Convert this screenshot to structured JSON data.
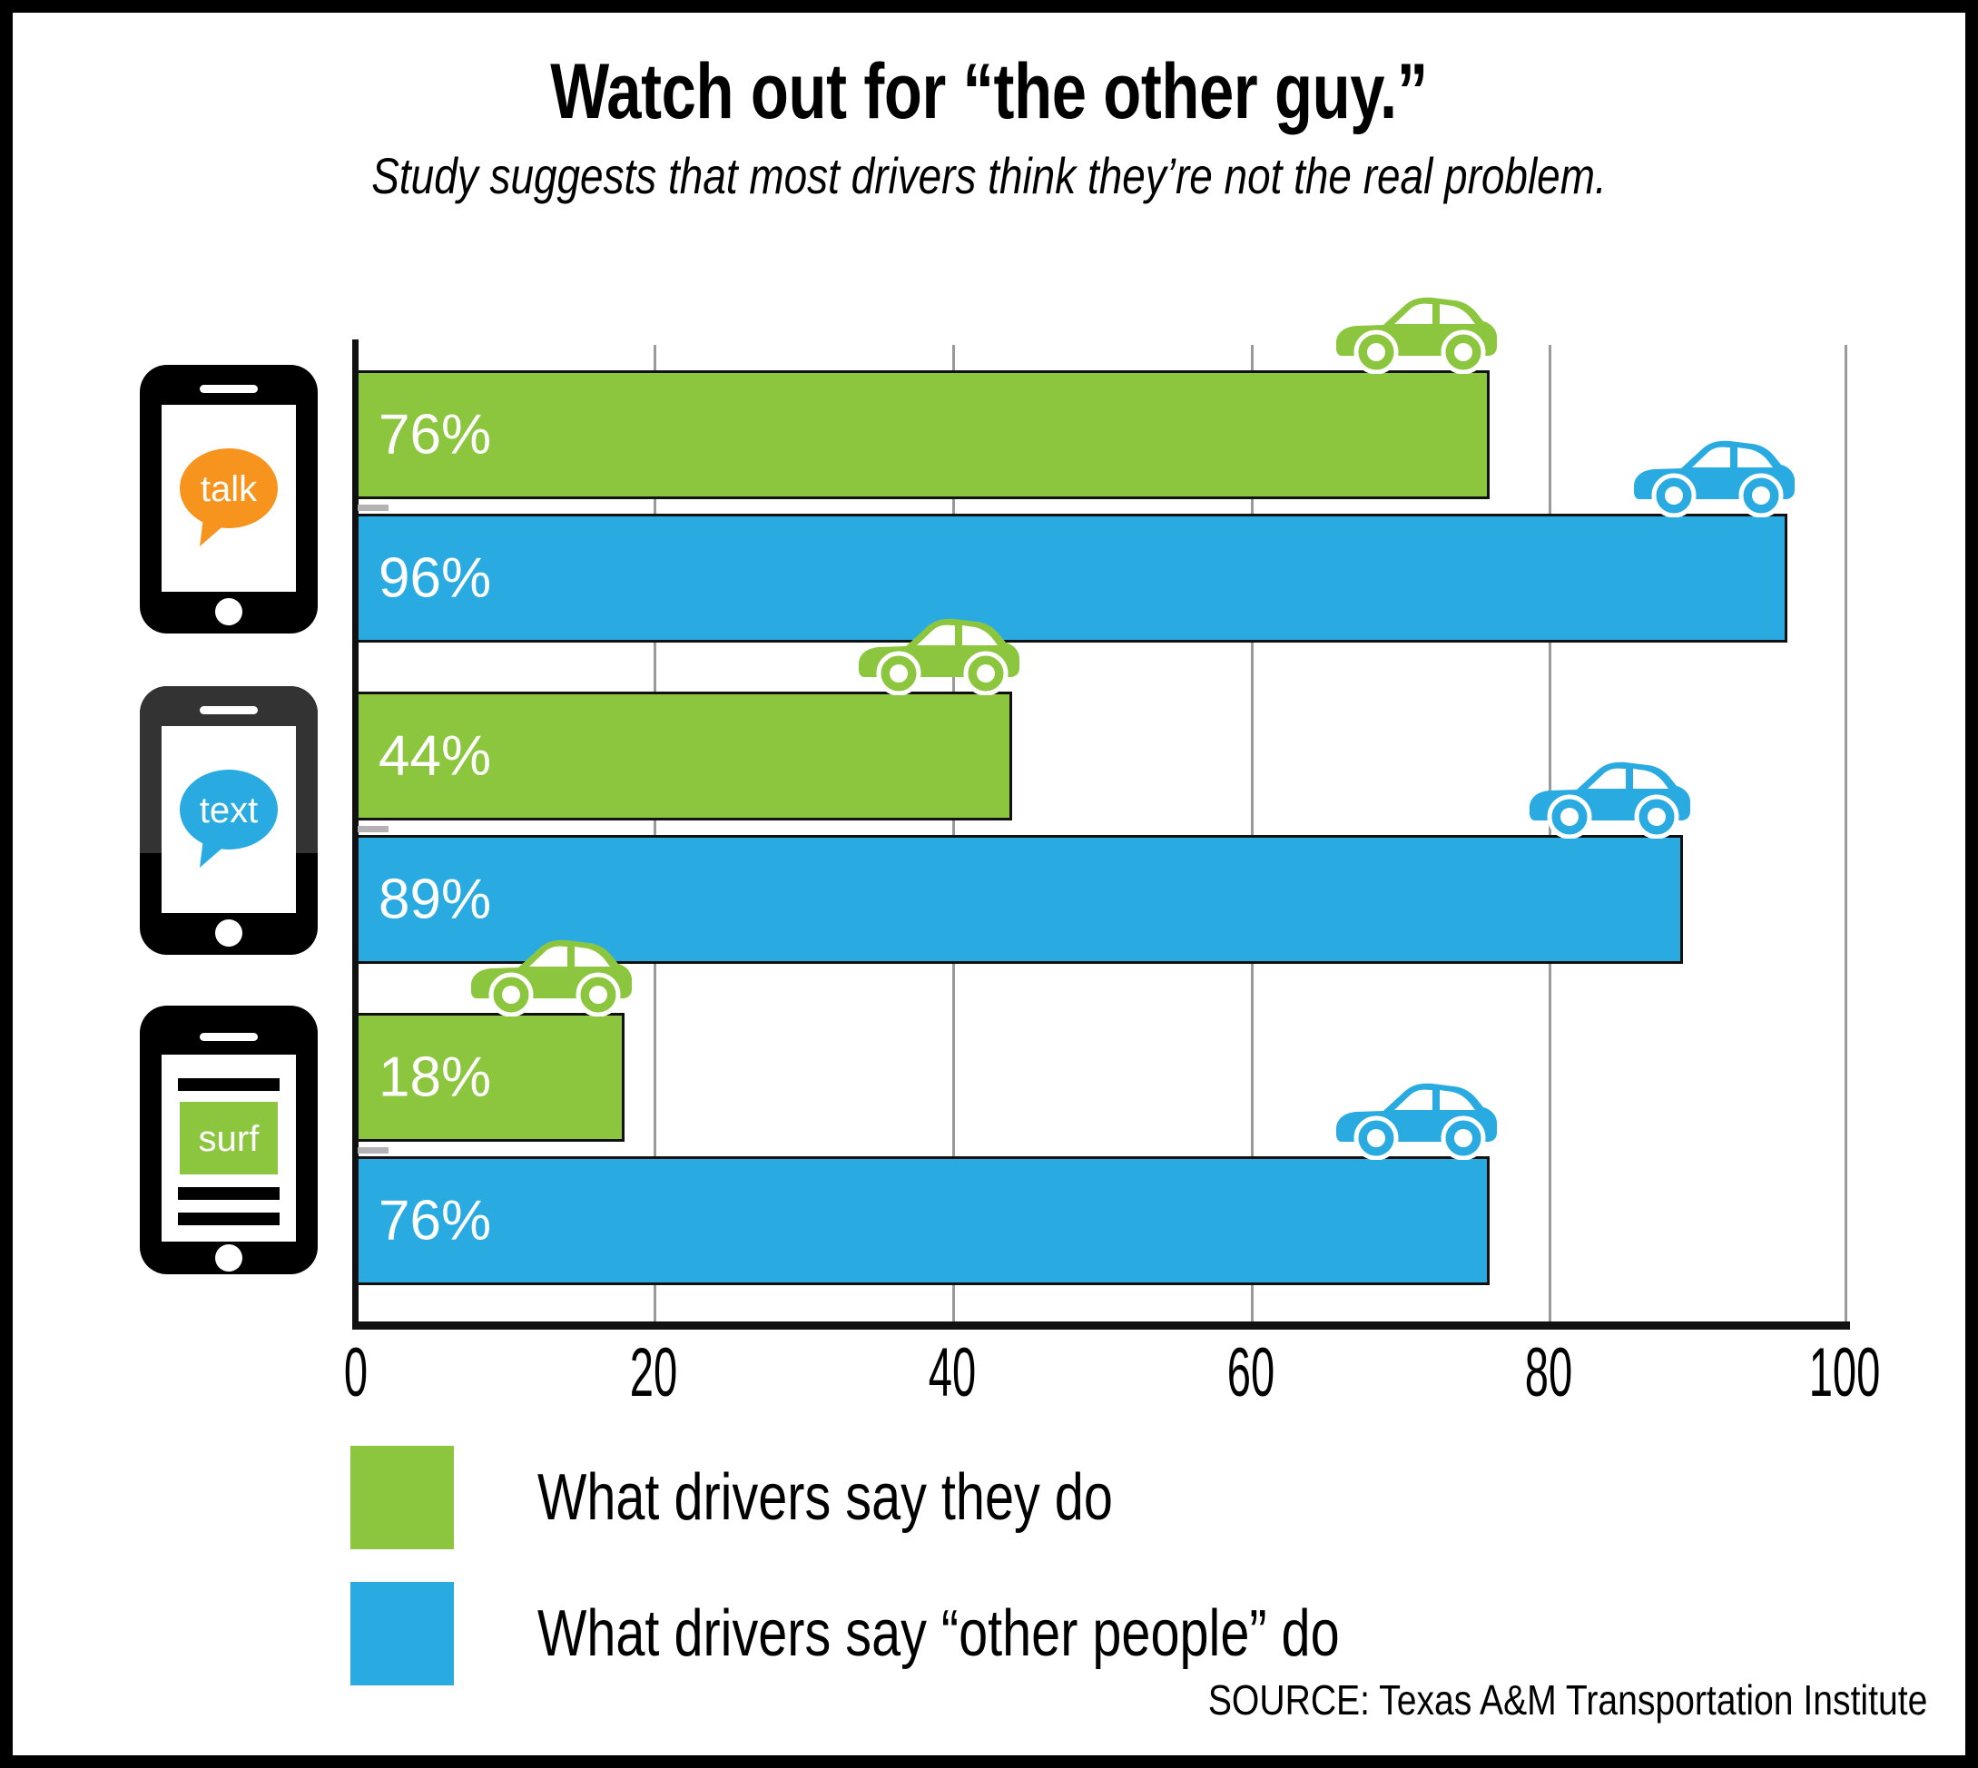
{
  "header": {
    "title": "Watch out for “the other guy.”",
    "subtitle": "Study suggests that most drivers think they’re not the real problem."
  },
  "colors": {
    "green": "#8CC63F",
    "blue": "#29ABE2",
    "orange": "#F7941E",
    "black": "#000000",
    "gridline": "#9A9A9A"
  },
  "categories": [
    {
      "key": "talk",
      "phone_label": "talk",
      "phone_style": "speech-bubble-orange"
    },
    {
      "key": "text",
      "phone_label": "text",
      "phone_style": "speech-bubble-blue"
    },
    {
      "key": "surf",
      "phone_label": "surf",
      "phone_style": "browser-green"
    }
  ],
  "bars": [
    {
      "category": "talk",
      "series": "self",
      "value": 76,
      "label": "76%"
    },
    {
      "category": "talk",
      "series": "other",
      "value": 96,
      "label": "96%"
    },
    {
      "category": "text",
      "series": "self",
      "value": 44,
      "label": "44%"
    },
    {
      "category": "text",
      "series": "other",
      "value": 89,
      "label": "89%"
    },
    {
      "category": "surf",
      "series": "self",
      "value": 18,
      "label": "18%"
    },
    {
      "category": "surf",
      "series": "other",
      "value": 76,
      "label": "76%"
    }
  ],
  "axis": {
    "ticks": [
      "0",
      "20",
      "40",
      "60",
      "80",
      "100"
    ],
    "min": 0,
    "max": 100
  },
  "legend": [
    {
      "color": "green",
      "label": "What drivers say they do"
    },
    {
      "color": "blue",
      "label": "What drivers say “other people” do"
    }
  ],
  "source": "SOURCE: Texas A&M Transportation Institute",
  "chart_data": {
    "type": "bar",
    "orientation": "horizontal",
    "title": "Watch out for “the other guy.”",
    "subtitle": "Study suggests that most drivers think they’re not the real problem.",
    "categories": [
      "talk",
      "text",
      "surf"
    ],
    "series": [
      {
        "name": "What drivers say they do",
        "color": "#8CC63F",
        "values": [
          76,
          44,
          18
        ]
      },
      {
        "name": "What drivers say “other people” do",
        "color": "#29ABE2",
        "values": [
          96,
          89,
          76
        ]
      }
    ],
    "xlabel": "",
    "ylabel": "",
    "xlim": [
      0,
      100
    ],
    "xticks": [
      0,
      20,
      40,
      60,
      80,
      100
    ],
    "grid": true,
    "grid_axis": "x",
    "legend_position": "bottom-left",
    "data_labels": [
      "76%",
      "96%",
      "44%",
      "89%",
      "18%",
      "76%"
    ],
    "annotations": [
      "car icon sits atop the end of each bar"
    ],
    "source": "SOURCE: Texas A&M Transportation Institute"
  }
}
